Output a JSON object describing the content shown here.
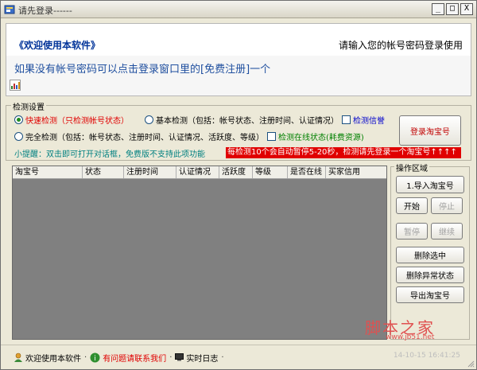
{
  "window": {
    "title": "请先登录------",
    "min": "_",
    "max": "□",
    "close": "X"
  },
  "banner": {
    "welcome": "《欢迎使用本软件》",
    "hint": "请输入您的帐号密码登录使用",
    "info": "如果没有帐号密码可以点击登录窗口里的[免费注册]一个"
  },
  "detect": {
    "legend": "检测设置",
    "fast_label": "快速检测",
    "fast_desc": "（只检测帐号状态）",
    "basic_label": "基本检测",
    "basic_desc": "（包括：帐号状态、注册时间、认证情况）",
    "credit_label": "检测信誉",
    "full_label": "完全检测",
    "full_desc": "（包括：帐号状态、注册时间、认证情况、活跃度、等级）",
    "online_label": "检测在线状态",
    "online_desc": "(耗费资源)",
    "tip": "小提醒：双击即可打开对话框，免费版不支持此项功能",
    "warning": "每检测10个会自动暂停5-20秒，检测请先登录一个淘宝号↑↑↑↑",
    "login_btn": "登录淘宝号"
  },
  "table": {
    "columns": [
      "淘宝号",
      "状态",
      "注册时间",
      "认证情况",
      "活跃度",
      "等级",
      "是否在线",
      "买家信用"
    ]
  },
  "ops": {
    "legend": "操作区域",
    "import": "1.导入淘宝号",
    "start": "开始",
    "stop": "停止",
    "pause": "暂停",
    "resume": "继续",
    "delete_selected": "删除选中",
    "delete_abnormal": "删除异常状态",
    "export": "导出淘宝号"
  },
  "watermark": {
    "text": "脚本之家",
    "url": "www.jb51.net"
  },
  "status": {
    "welcome": "欢迎使用本软件",
    "contact": "有问题请联系我们",
    "log": "实时日志",
    "time": "14-10-15 16:41:25"
  }
}
